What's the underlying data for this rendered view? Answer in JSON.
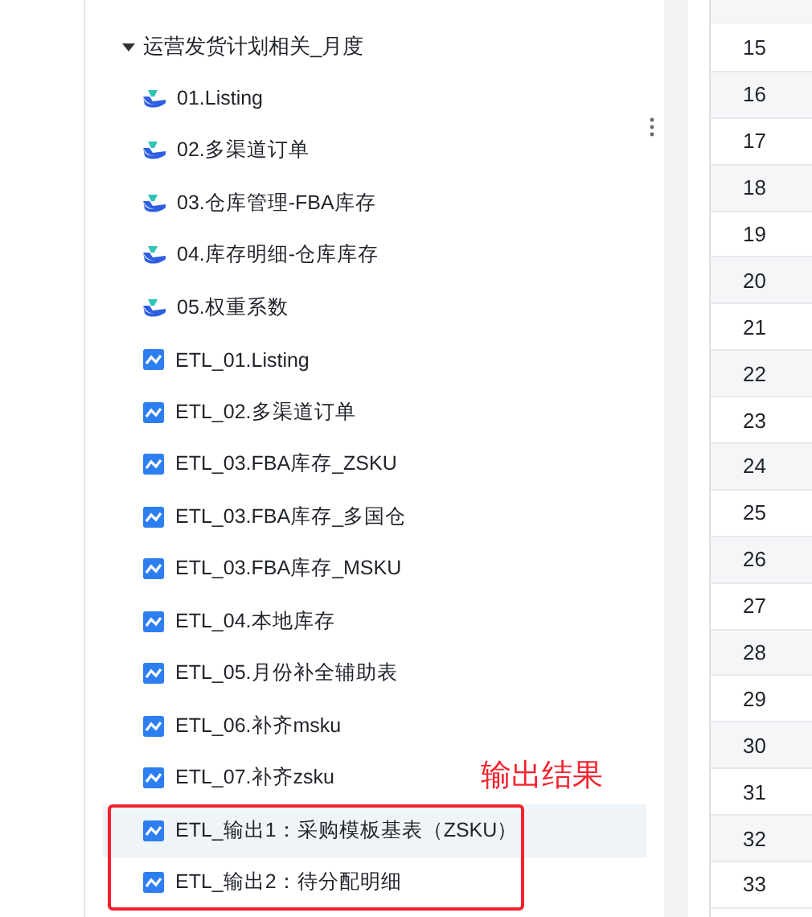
{
  "tree": {
    "label": "运营发货计划相关_月度",
    "expanded": true,
    "children": [
      {
        "label": "01.Listing",
        "kind": "sheet",
        "selected": false
      },
      {
        "label": "02.多渠道订单",
        "kind": "sheet",
        "selected": false
      },
      {
        "label": "03.仓库管理-FBA库存",
        "kind": "sheet",
        "selected": false
      },
      {
        "label": "04.库存明细-仓库库存",
        "kind": "sheet",
        "selected": false
      },
      {
        "label": "05.权重系数",
        "kind": "sheet",
        "selected": false
      },
      {
        "label": "ETL_01.Listing",
        "kind": "etl",
        "selected": false
      },
      {
        "label": "ETL_02.多渠道订单",
        "kind": "etl",
        "selected": false
      },
      {
        "label": "ETL_03.FBA库存_ZSKU",
        "kind": "etl",
        "selected": false
      },
      {
        "label": "ETL_03.FBA库存_多国仓",
        "kind": "etl",
        "selected": false
      },
      {
        "label": "ETL_03.FBA库存_MSKU",
        "kind": "etl",
        "selected": false
      },
      {
        "label": "ETL_04.本地库存",
        "kind": "etl",
        "selected": false
      },
      {
        "label": "ETL_05.月份补全辅助表",
        "kind": "etl",
        "selected": false
      },
      {
        "label": "ETL_06.补齐msku",
        "kind": "etl",
        "selected": false
      },
      {
        "label": "ETL_07.补齐zsku",
        "kind": "etl",
        "selected": false
      },
      {
        "label": "ETL_输出1：采购模板基表（ZSKU）",
        "kind": "etl",
        "selected": true
      },
      {
        "label": "ETL_输出2：待分配明细",
        "kind": "etl",
        "selected": false
      }
    ]
  },
  "annotation": {
    "text": "输出结果"
  },
  "table": {
    "rows": [
      "15",
      "16",
      "17",
      "18",
      "19",
      "20",
      "21",
      "22",
      "23",
      "24",
      "25",
      "26",
      "27",
      "28",
      "29",
      "30",
      "31",
      "32",
      "33"
    ]
  }
}
